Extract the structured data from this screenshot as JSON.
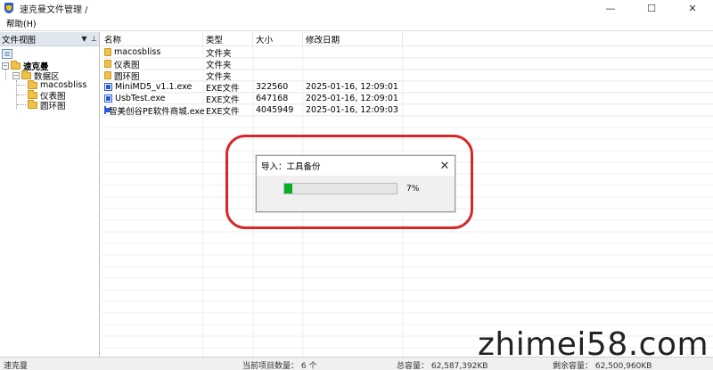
{
  "window": {
    "title": "速克曼文件管理 /",
    "minimize_label": "—",
    "maximize_label": "☐",
    "close_label": "✕"
  },
  "menu": {
    "items": [
      {
        "label": "帮助(H)"
      }
    ]
  },
  "left_pane": {
    "header_title": "文件视图",
    "dropdown_glyph": "▼",
    "pin_glyph": "⊥",
    "tree": {
      "root": {
        "label": "速克曼",
        "expander": "−"
      },
      "data_area": {
        "label": "数据区",
        "expander": "−"
      },
      "children": [
        {
          "label": "macosbliss"
        },
        {
          "label": "仪表图"
        },
        {
          "label": "圆环图"
        }
      ]
    }
  },
  "file_list": {
    "columns": [
      {
        "label": "名称"
      },
      {
        "label": "类型"
      },
      {
        "label": "大小"
      },
      {
        "label": "修改日期"
      }
    ],
    "rows": [
      {
        "name": "macosbliss",
        "type": "文件夹",
        "size": "",
        "date": "",
        "icon": "folder-icon"
      },
      {
        "name": "仪表图",
        "type": "文件夹",
        "size": "",
        "date": "",
        "icon": "folder-icon"
      },
      {
        "name": "圆环图",
        "type": "文件夹",
        "size": "",
        "date": "",
        "icon": "folder-icon"
      },
      {
        "name": "MiniMD5_v1.1.exe",
        "type": "EXE文件",
        "size": "322560",
        "date": "2025-01-16, 12:09:01",
        "icon": "exe-icon"
      },
      {
        "name": "UsbTest.exe",
        "type": "EXE文件",
        "size": "647168",
        "date": "2025-01-16, 12:09:01",
        "icon": "exe-icon"
      },
      {
        "name": "智美创谷PE软件商城.exe",
        "type": "EXE文件",
        "size": "4045949",
        "date": "2025-01-16, 12:09:03",
        "icon": "exe-icon"
      }
    ]
  },
  "dialog": {
    "title": "导入：工具备份",
    "close_label": "✕",
    "progress_fraction": 0.07,
    "progress_text": "7%"
  },
  "statusbar": {
    "left": "速克曼",
    "item_count": "当前项目数量： 6 个",
    "total_capacity": "总容量： 62,587,392KB",
    "free_capacity": "剩余容量： 62,500,960KB"
  },
  "watermark": {
    "text": "zhimei58.com"
  },
  "colors": {
    "accent_highlight": "#d62828",
    "progress_fill": "#06b025",
    "folder": "#f0c24a"
  }
}
